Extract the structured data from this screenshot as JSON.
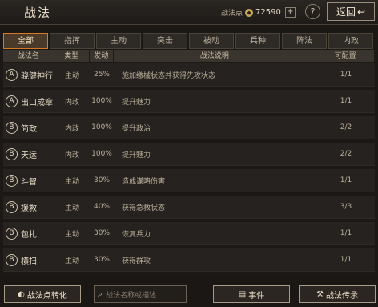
{
  "header": {
    "title": "战法",
    "points_label": "战法点",
    "points_value": "72590",
    "plus": "+",
    "help": "?",
    "back_label": "返回",
    "back_icon": "↩"
  },
  "tabs": [
    "全部",
    "指挥",
    "主动",
    "突击",
    "被动",
    "兵种",
    "阵法",
    "内政"
  ],
  "active_tab": 0,
  "columns": [
    "战法名",
    "类型",
    "发动",
    "战法说明",
    "可配置"
  ],
  "skills": [
    {
      "grade": "A",
      "name": "骁健神行",
      "type": "主动",
      "rate": "25%",
      "desc": "施加缴械状态并获得先攻状态",
      "config": "1/1"
    },
    {
      "grade": "A",
      "name": "出口成章",
      "type": "内政",
      "rate": "100%",
      "desc": "提升魅力",
      "config": "1/1"
    },
    {
      "grade": "B",
      "name": "简政",
      "type": "内政",
      "rate": "100%",
      "desc": "提升政治",
      "config": "2/2"
    },
    {
      "grade": "B",
      "name": "天运",
      "type": "内政",
      "rate": "100%",
      "desc": "提升魅力",
      "config": "2/2"
    },
    {
      "grade": "B",
      "name": "斗智",
      "type": "主动",
      "rate": "30%",
      "desc": "造成谋略伤害",
      "config": "1/1"
    },
    {
      "grade": "B",
      "name": "援救",
      "type": "主动",
      "rate": "40%",
      "desc": "获得急救状态",
      "config": "3/3"
    },
    {
      "grade": "B",
      "name": "包扎",
      "type": "主动",
      "rate": "30%",
      "desc": "恢复兵力",
      "config": "1/1"
    },
    {
      "grade": "B",
      "name": "横扫",
      "type": "主动",
      "rate": "30%",
      "desc": "获得群攻",
      "config": "1/1"
    }
  ],
  "footer": {
    "convert_label": "战法点转化",
    "search_placeholder": "战法名称或描述",
    "event_label": "事件",
    "inherit_label": "战法传承"
  }
}
